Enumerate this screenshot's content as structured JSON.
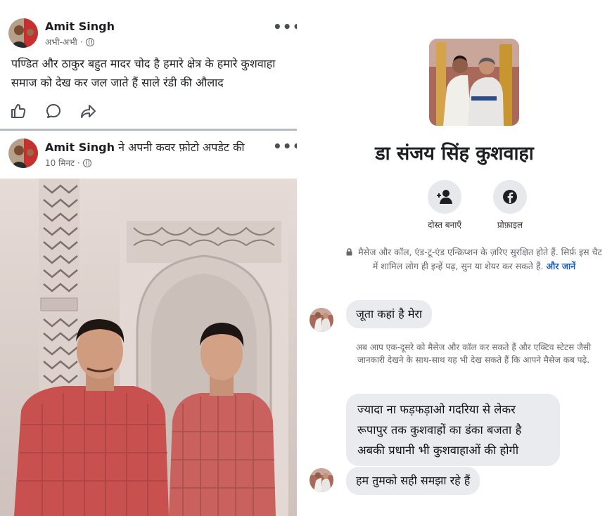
{
  "post1": {
    "author": "Amit Singh",
    "time": "अभी-अभी",
    "text": "पण्डित और ठाकुर बहुत मादर चोद है हमारे क्षेत्र के हमारे कुशवाहा समाज को देख कर जल जाते हैं साले रंडी की औलाद",
    "more": "•••"
  },
  "post2": {
    "author": "Amit Singh",
    "action": " ने अपनी कवर फ़ोटो अपडेट की",
    "time": "10 मिनट ·",
    "more": "•••"
  },
  "messenger": {
    "profile_name": "डा संजय सिंह कुशवाहा",
    "add_friend_label": "दोस्त बनाएँ",
    "profile_label": "प्रोफ़ाइल",
    "encryption_note": "मैसेज और कॉल, एंड-टू-एंड एन्क्रिप्शन के ज़रिए सुरक्षित होते हैं. सिर्फ़ इस चैट में शामिल लोग ही इन्हें पढ़, सुन या शेयर कर सकते हैं.",
    "learn_more": "और जानें",
    "system_note": "अब आप एक-दूसरे को मैसेज और कॉल कर सकते हैं और एक्टिव स्टेटस जैसी जानकारी देखने के साथ-साथ यह भी देख सकते हैं कि आपने मैसेज कब पढ़े.",
    "messages": [
      {
        "text": "जूता कहां है मेरा"
      },
      {
        "line1": "ज्यादा ना फड़फड़ाओ गदरिया से लेकर",
        "line2": "रूपापुर तक कुशवाहों का डंका बजता है",
        "line3": "अबकी प्रधानी भी कुशवाहाओं की होगी"
      },
      {
        "text": "हम तुमको सही समझा रहे हैं"
      }
    ]
  },
  "colors": {
    "meta_gray": "#65676b",
    "bubble_bg": "#e9ebee",
    "link_blue": "#1a5fb4",
    "button_bg": "#e6e8eb"
  },
  "icons": [
    "like-icon",
    "comment-icon",
    "share-icon",
    "globe-icon",
    "add-friend-icon",
    "facebook-icon",
    "lock-icon",
    "more-options-icon"
  ]
}
